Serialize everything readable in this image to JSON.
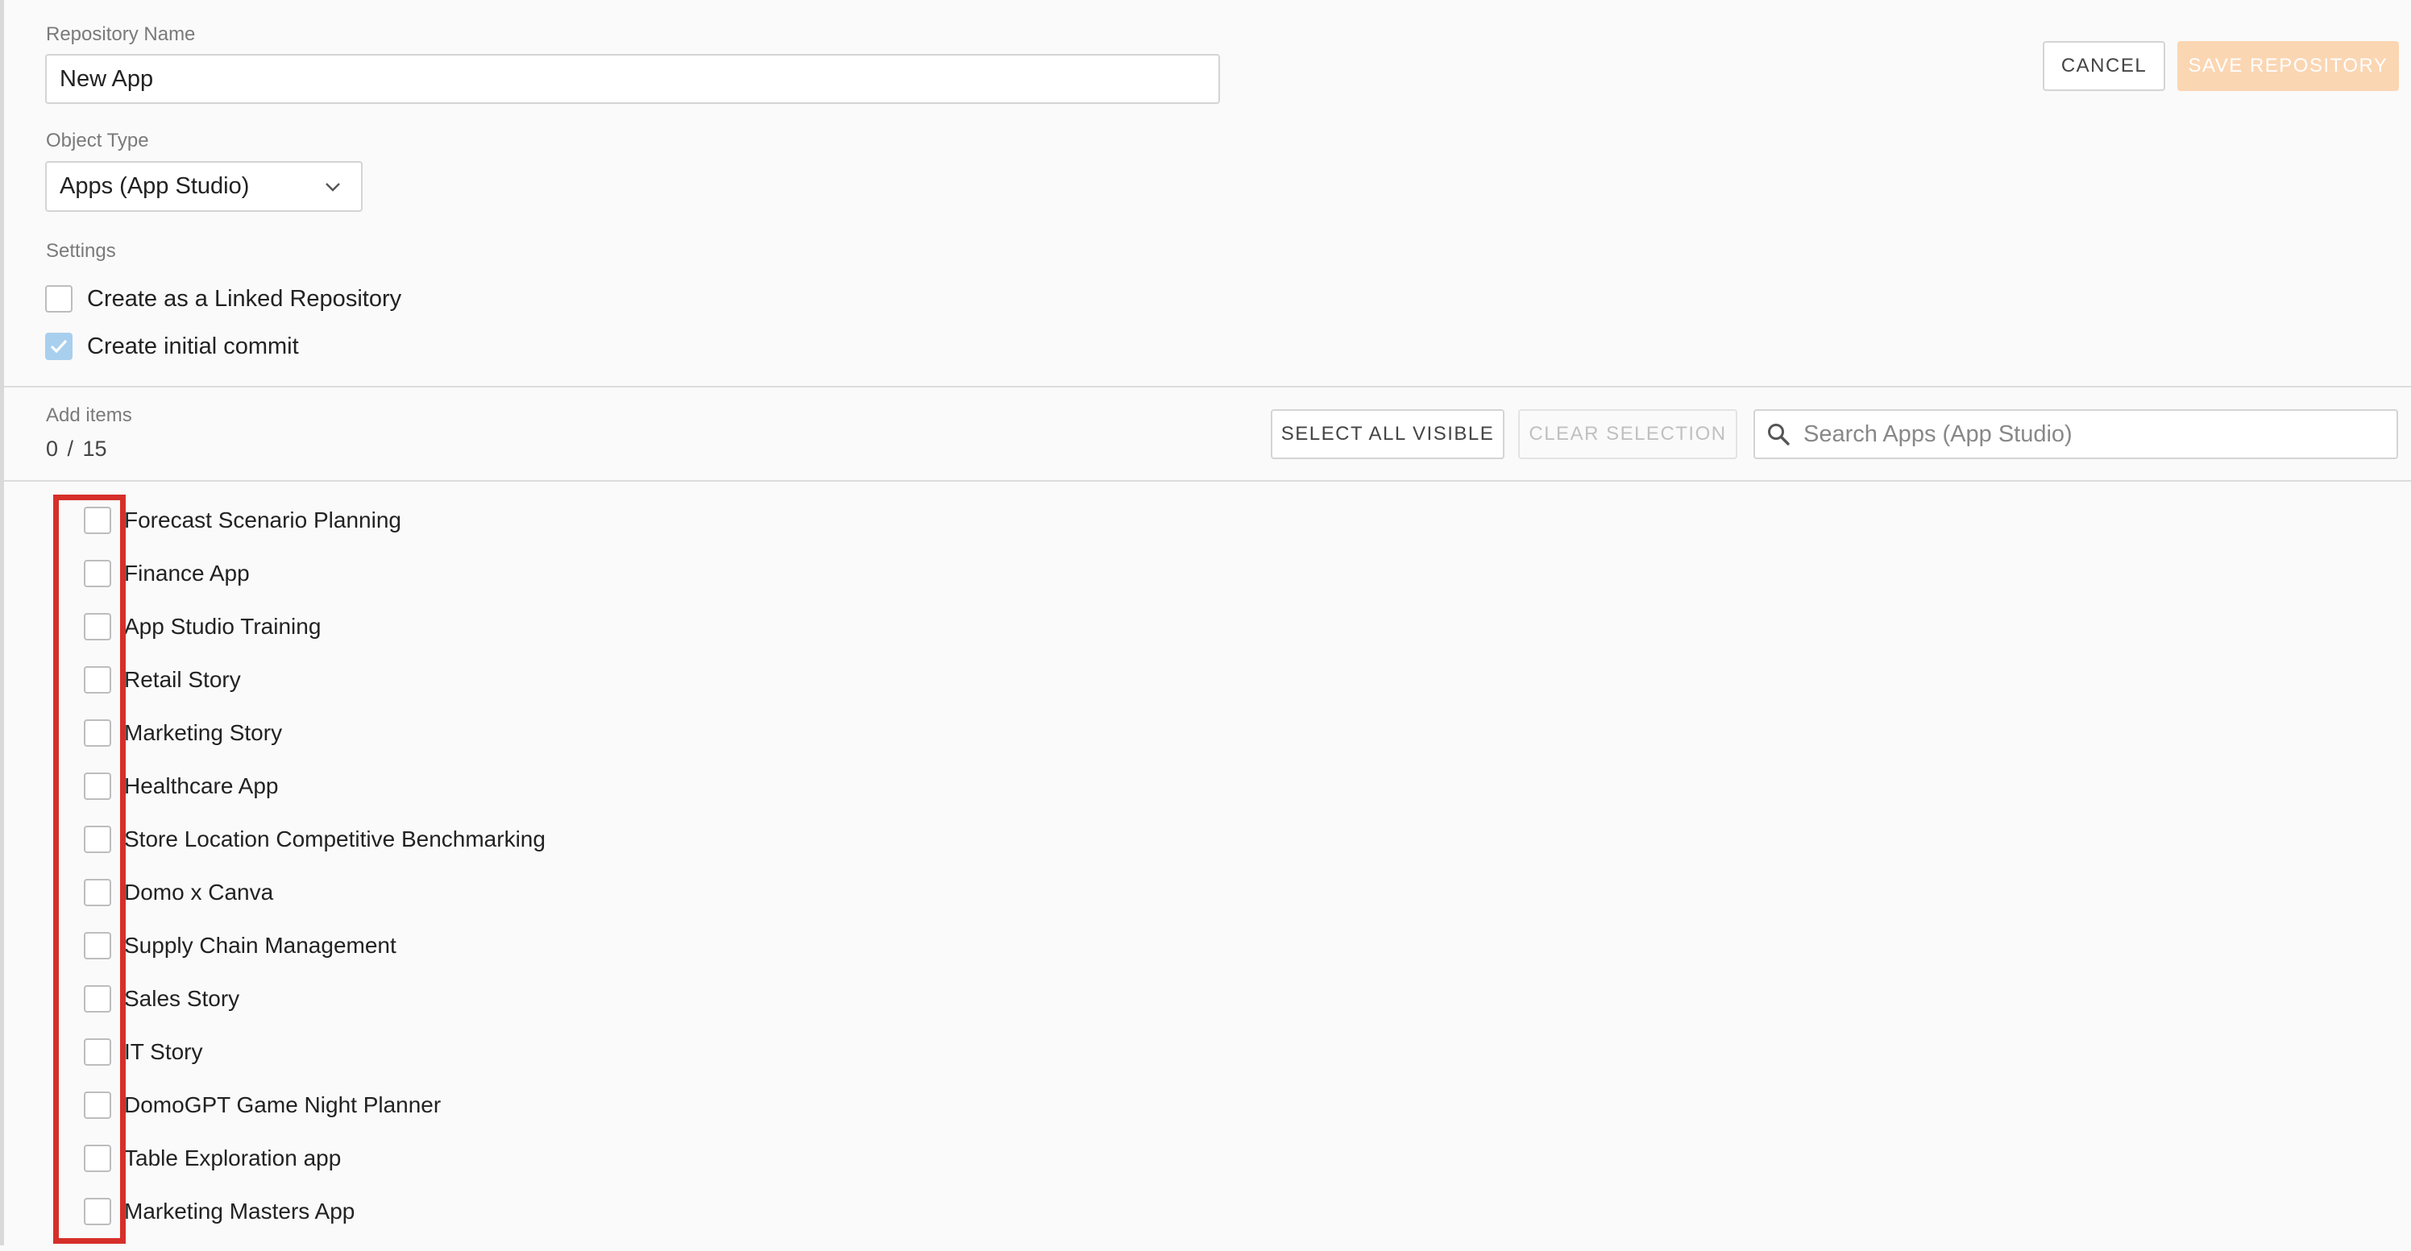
{
  "form": {
    "repo_name_label": "Repository Name",
    "repo_name_value": "New App",
    "object_type_label": "Object Type",
    "object_type_selected": "Apps (App Studio)",
    "settings_label": "Settings",
    "settings": [
      {
        "label": "Create as a Linked Repository",
        "checked": false
      },
      {
        "label": "Create initial commit",
        "checked": true
      }
    ]
  },
  "actions": {
    "cancel_label": "CANCEL",
    "save_label": "SAVE REPOSITORY"
  },
  "add_items": {
    "title": "Add items",
    "count_text": "0 / 15",
    "select_all_label": "SELECT ALL VISIBLE",
    "clear_selection_label": "CLEAR SELECTION",
    "search_placeholder": "Search Apps (App Studio)",
    "items": [
      {
        "label": "Forecast Scenario Planning",
        "checked": false
      },
      {
        "label": "Finance App",
        "checked": false
      },
      {
        "label": "App Studio Training",
        "checked": false
      },
      {
        "label": "Retail Story",
        "checked": false
      },
      {
        "label": "Marketing Story",
        "checked": false
      },
      {
        "label": "Healthcare App",
        "checked": false
      },
      {
        "label": "Store Location Competitive Benchmarking",
        "checked": false
      },
      {
        "label": "Domo x Canva",
        "checked": false
      },
      {
        "label": "Supply Chain Management",
        "checked": false
      },
      {
        "label": "Sales Story",
        "checked": false
      },
      {
        "label": "IT Story",
        "checked": false
      },
      {
        "label": "DomoGPT Game Night Planner",
        "checked": false
      },
      {
        "label": "Table Exploration app",
        "checked": false
      },
      {
        "label": "Marketing Masters App",
        "checked": false
      }
    ]
  },
  "colors": {
    "background": "#fafafa",
    "checked_checkbox": "#a9cfee",
    "save_button_disabled": "#fbd6b3",
    "highlight_outline": "#d62f2a"
  },
  "icons": {
    "select_chevron": "chevron-down-icon",
    "search": "search-icon",
    "checkmark": "checkmark-icon"
  }
}
